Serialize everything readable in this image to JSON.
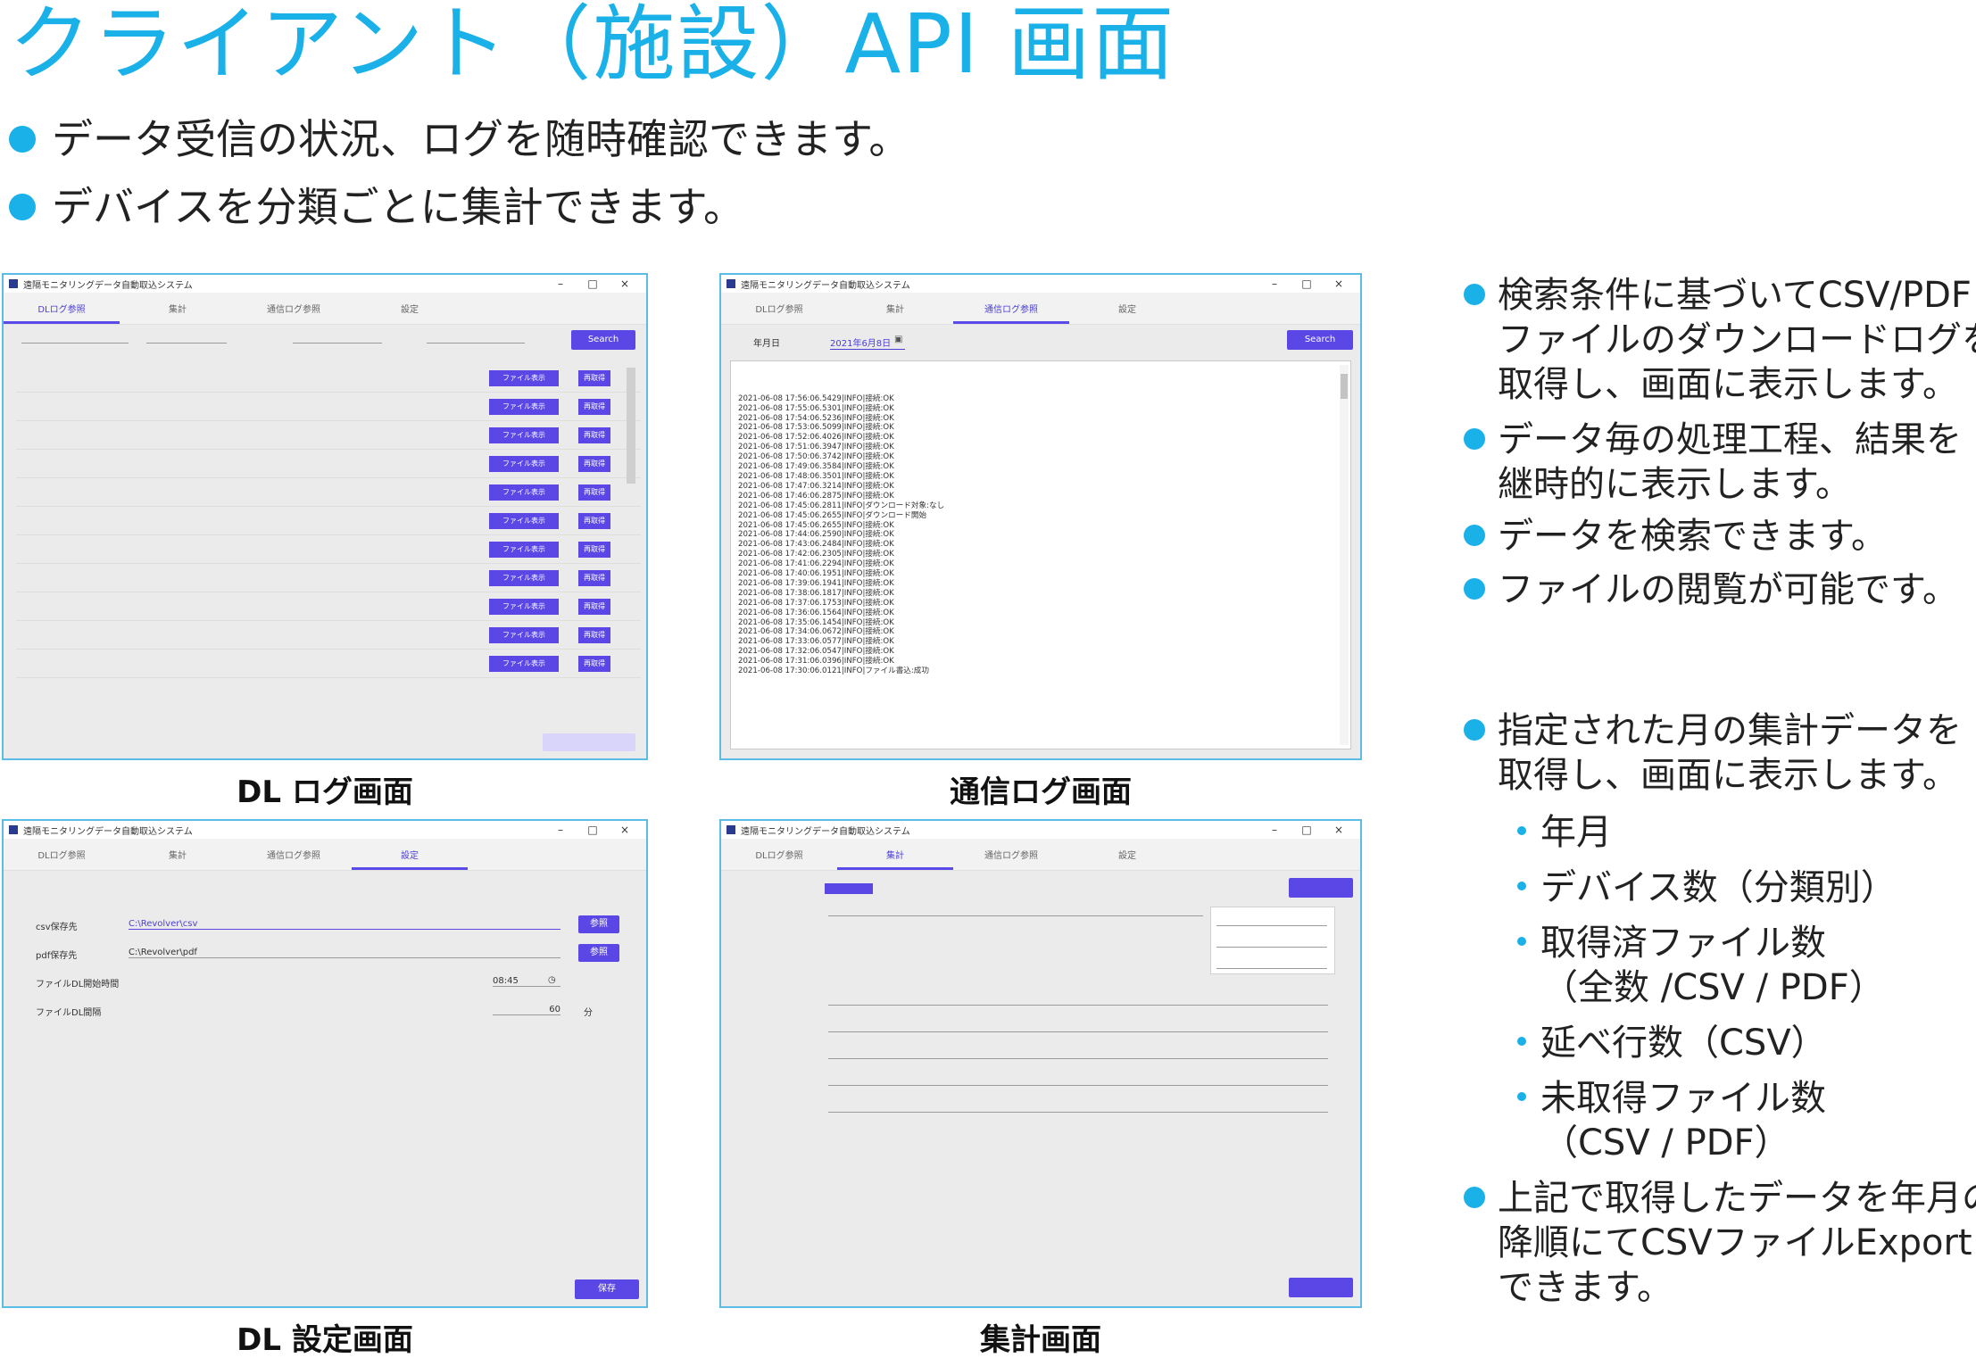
{
  "page": {
    "title": "クライアント（施設）API 画面",
    "intro": [
      "データ受信の状況、ログを随時確認できます。",
      "デバイスを分類ごとに集計できます。"
    ],
    "accent_color": "#1ab0e8",
    "button_color": "#5a47e6"
  },
  "windows": {
    "dl_log": {
      "caption": "DL ログ画面",
      "app_title": "遠隔モニタリングデータ自動取込システム",
      "tabs": [
        "DLログ参照",
        "集計",
        "通信ログ参照",
        "設定"
      ],
      "active_tab": 0,
      "search_label": "Search",
      "row_button_1": "ファイル表示",
      "row_button_2": "再取得",
      "row_count": 11
    },
    "comm_log": {
      "caption": "通信ログ画面",
      "app_title": "遠隔モニタリングデータ自動取込システム",
      "tabs": [
        "DLログ参照",
        "集計",
        "通信ログ参照",
        "設定"
      ],
      "active_tab": 2,
      "date_label": "年月日",
      "date_value": "2021年6月8日",
      "search_label": "Search",
      "log_lines": [
        "2021-06-08 17:56:06.5429|INFO|接続:OK",
        "2021-06-08 17:55:06.5301|INFO|接続:OK",
        "2021-06-08 17:54:06.5236|INFO|接続:OK",
        "2021-06-08 17:53:06.5099|INFO|接続:OK",
        "2021-06-08 17:52:06.4026|INFO|接続:OK",
        "2021-06-08 17:51:06.3947|INFO|接続:OK",
        "2021-06-08 17:50:06.3742|INFO|接続:OK",
        "2021-06-08 17:49:06.3584|INFO|接続:OK",
        "2021-06-08 17:48:06.3501|INFO|接続:OK",
        "2021-06-08 17:47:06.3214|INFO|接続:OK",
        "2021-06-08 17:46:06.2875|INFO|接続:OK",
        "2021-06-08 17:45:06.2811|INFO|ダウンロード対象:なし",
        "2021-06-08 17:45:06.2655|INFO|ダウンロード開始",
        "2021-06-08 17:45:06.2655|INFO|接続:OK",
        "2021-06-08 17:44:06.2590|INFO|接続:OK",
        "2021-06-08 17:43:06.2484|INFO|接続:OK",
        "2021-06-08 17:42:06.2305|INFO|接続:OK",
        "2021-06-08 17:41:06.2294|INFO|接続:OK",
        "2021-06-08 17:40:06.1951|INFO|接続:OK",
        "2021-06-08 17:39:06.1941|INFO|接続:OK",
        "2021-06-08 17:38:06.1817|INFO|接続:OK",
        "2021-06-08 17:37:06.1753|INFO|接続:OK",
        "2021-06-08 17:36:06.1564|INFO|接続:OK",
        "2021-06-08 17:35:06.1454|INFO|接続:OK",
        "2021-06-08 17:34:06.0672|INFO|接続:OK",
        "2021-06-08 17:33:06.0577|INFO|接続:OK",
        "2021-06-08 17:32:06.0547|INFO|接続:OK",
        "2021-06-08 17:31:06.0396|INFO|接続:OK",
        "2021-06-08 17:30:06.0121|INFO|ファイル書込:成功"
      ]
    },
    "dl_settings": {
      "caption": "DL 設定画面",
      "app_title": "遠隔モニタリングデータ自動取込システム",
      "tabs": [
        "DLログ参照",
        "集計",
        "通信ログ参照",
        "設定"
      ],
      "active_tab": 3,
      "csv_label": "csv保存先",
      "csv_value": "C:\\Revolver\\csv",
      "pdf_label": "pdf保存先",
      "pdf_value": "C:\\Revolver\\pdf",
      "browse_label": "参照",
      "start_label": "ファイルDL開始時間",
      "start_value": "08:45",
      "interval_label": "ファイルDL間隔",
      "interval_value": "60",
      "interval_unit": "分",
      "save_label": "保存"
    },
    "summary": {
      "caption": "集計画面",
      "app_title": "遠隔モニタリングデータ自動取込システム",
      "tabs": [
        "DLログ参照",
        "集計",
        "通信ログ参照",
        "設定"
      ],
      "active_tab": 1
    }
  },
  "right": {
    "bullets_a": [
      [
        "検索条件に基づいてCSV/PDF",
        "ファイルのダウンロードログを",
        "取得し、画面に表示します。"
      ],
      [
        "データ毎の処理工程、結果を",
        "継時的に表示します。"
      ],
      [
        "データを検索できます。"
      ],
      [
        "ファイルの閲覧が可能です。"
      ]
    ],
    "bullet_b": [
      "指定された月の集計データを",
      "取得し、画面に表示します。"
    ],
    "subs": [
      [
        "年月"
      ],
      [
        "デバイス数（分類別）"
      ],
      [
        "取得済ファイル数",
        "（全数 /CSV / PDF）"
      ],
      [
        "延べ行数（CSV）"
      ],
      [
        "未取得ファイル数",
        "（CSV / PDF）"
      ]
    ],
    "bullet_c": [
      "上記で取得したデータを年月の",
      "降順にてCSVファイルExport",
      "できます。"
    ]
  }
}
